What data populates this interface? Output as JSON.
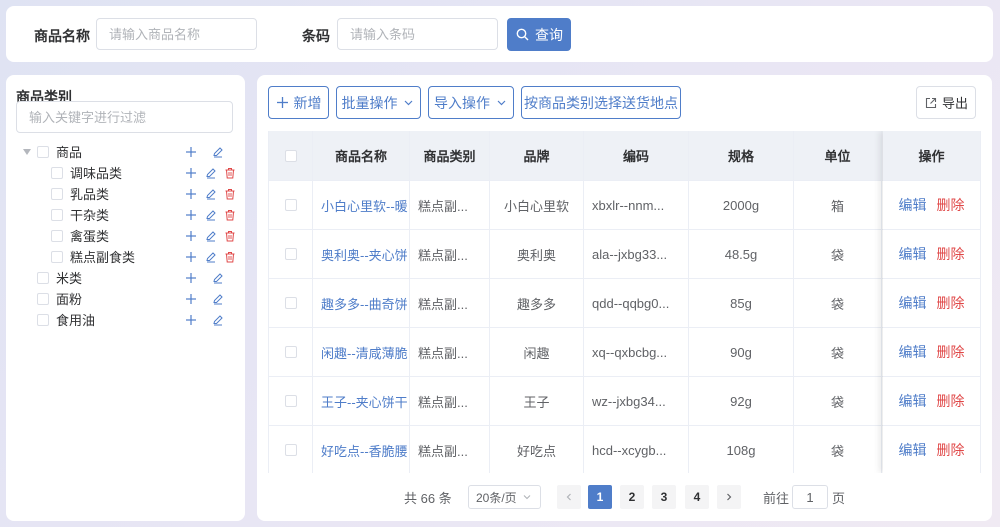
{
  "search": {
    "name_label": "商品名称",
    "name_placeholder": "请输入商品名称",
    "code_label": "条码",
    "code_placeholder": "请输入条码",
    "query_label": "查询"
  },
  "tree": {
    "title": "商品类别",
    "filter_placeholder": "输入关键字进行过滤",
    "nodes": [
      {
        "label": "商品",
        "level": 0
      },
      {
        "label": "调味品类",
        "level": 1
      },
      {
        "label": "乳品类",
        "level": 1
      },
      {
        "label": "干杂类",
        "level": 1
      },
      {
        "label": "禽蛋类",
        "level": 1
      },
      {
        "label": "糕点副食类",
        "level": 1
      },
      {
        "label": "米类",
        "level": 0
      },
      {
        "label": "面粉",
        "level": 0
      },
      {
        "label": "食用油",
        "level": 0
      }
    ]
  },
  "toolbar": {
    "add_label": "新增",
    "batch_label": "批量操作",
    "import_label": "导入操作",
    "dispatch_label": "按商品类别选择送货地点",
    "export_label": "导出"
  },
  "table": {
    "columns": [
      "商品名称",
      "商品类别",
      "品牌",
      "编码",
      "规格",
      "单位",
      "操作"
    ],
    "rows": [
      {
        "name": "小白心里软--暖",
        "category": "糕点副...",
        "brand": "小白心里软",
        "code": "xbxlr--nnm...",
        "spec": "2000g",
        "unit": "箱"
      },
      {
        "name": "奥利奥--夹心饼",
        "category": "糕点副...",
        "brand": "奥利奥",
        "code": "ala--jxbg33...",
        "spec": "48.5g",
        "unit": "袋"
      },
      {
        "name": "趣多多--曲奇饼",
        "category": "糕点副...",
        "brand": "趣多多",
        "code": "qdd--qqbg0...",
        "spec": "85g",
        "unit": "袋"
      },
      {
        "name": "闲趣--清咸薄脆",
        "category": "糕点副...",
        "brand": "闲趣",
        "code": "xq--qxbcbg...",
        "spec": "90g",
        "unit": "袋"
      },
      {
        "name": "王子--夹心饼干",
        "category": "糕点副...",
        "brand": "王子",
        "code": "wz--jxbg34...",
        "spec": "92g",
        "unit": "袋"
      },
      {
        "name": "好吃点--香脆腰",
        "category": "糕点副...",
        "brand": "好吃点",
        "code": "hcd--xcygb...",
        "spec": "108g",
        "unit": "袋"
      }
    ],
    "edit_label": "编辑",
    "delete_label": "删除"
  },
  "pagination": {
    "total_text": "共 66 条",
    "page_size": "20条/页",
    "pages": [
      "1",
      "2",
      "3",
      "4"
    ],
    "current_page": "1",
    "goto_prefix": "前往",
    "goto_value": "1",
    "goto_suffix": "页"
  },
  "colors": {
    "primary": "#4f7dc9",
    "danger": "#e04848",
    "header_bg": "#eef1f6"
  },
  "icons": [
    "search-icon",
    "plus-icon",
    "edit-icon",
    "delete-icon",
    "chevron-down-icon",
    "export-icon",
    "chevron-left-icon",
    "chevron-right-icon",
    "caret-down-icon"
  ]
}
